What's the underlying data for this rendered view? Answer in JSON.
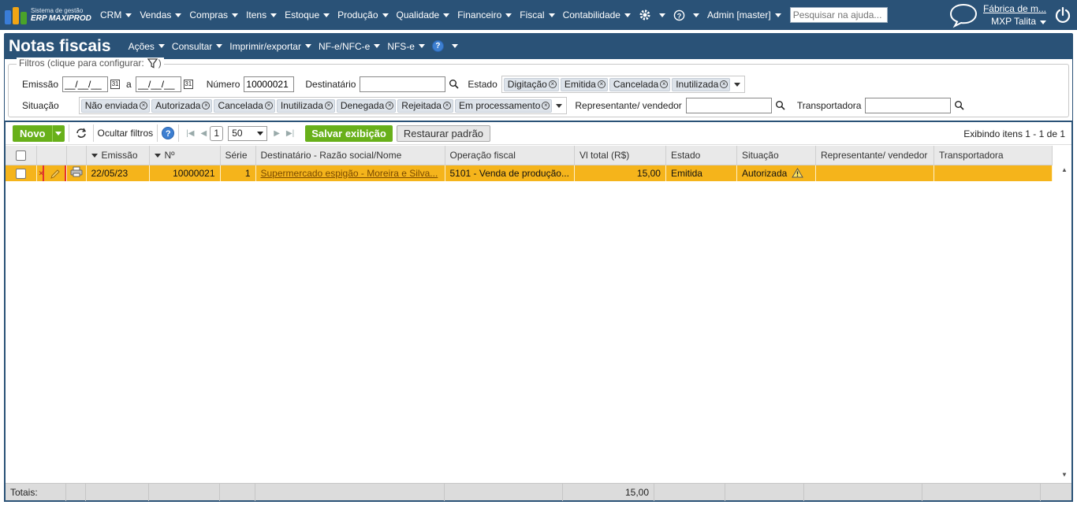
{
  "app": {
    "logo_line1": "Sistema de gestão",
    "logo_line2": "ERP MAXIPROD",
    "menu": [
      "CRM",
      "Vendas",
      "Compras",
      "Itens",
      "Estoque",
      "Produção",
      "Qualidade",
      "Financeiro",
      "Fiscal",
      "Contabilidade"
    ],
    "user": "Admin [master]",
    "search_placeholder": "Pesquisar na ajuda...",
    "company": "Fábrica de m...",
    "company_user": "MXP Talita"
  },
  "page": {
    "title": "Notas fiscais",
    "menus": [
      "Ações",
      "Consultar",
      "Imprimir/exportar",
      "NF-e/NFC-e",
      "NFS-e"
    ]
  },
  "filters": {
    "legend": "Filtros (clique para configurar:",
    "legend_end": ")",
    "emissao_label": "Emissão",
    "emissao_from": "__/__/__",
    "a_label": "a",
    "emissao_to": "__/__/__",
    "numero_label": "Número",
    "numero_value": "10000021",
    "destinatario_label": "Destinatário",
    "destinatario_value": "",
    "estado_label": "Estado",
    "estado_tags": [
      "Digitação",
      "Emitida",
      "Cancelada",
      "Inutilizada"
    ],
    "situacao_label": "Situação",
    "situacao_tags": [
      "Não enviada",
      "Autorizada",
      "Cancelada",
      "Inutilizada",
      "Denegada",
      "Rejeitada",
      "Em processamento"
    ],
    "representante_label": "Representante/ vendedor",
    "representante_value": "",
    "transportadora_label": "Transportadora",
    "transportadora_value": ""
  },
  "toolbar": {
    "novo": "Novo",
    "ocultar": "Ocultar filtros",
    "page": "1",
    "page_size": "50",
    "salvar": "Salvar exibição",
    "restaurar": "Restaurar padrão",
    "exibindo": "Exibindo itens 1 - 1 de 1"
  },
  "grid": {
    "columns": [
      "Emissão",
      "Nº",
      "Série",
      "Destinatário - Razão social/Nome",
      "Operação fiscal",
      "Vl total (R$)",
      "Estado",
      "Situação",
      "Representante/ vendedor",
      "Transportadora"
    ],
    "rows": [
      {
        "emissao": "22/05/23",
        "numero": "10000021",
        "serie": "1",
        "destinatario": "Supermercado espigão - Moreira e Silva...",
        "operacao": "5101 - Venda de produção...",
        "vl_total": "15,00",
        "estado": "Emitida",
        "situacao": "Autorizada",
        "representante": "",
        "transportadora": ""
      }
    ],
    "totals_label": "Totais:",
    "totals_value": "15,00",
    "row_color": "#f5b41b"
  }
}
